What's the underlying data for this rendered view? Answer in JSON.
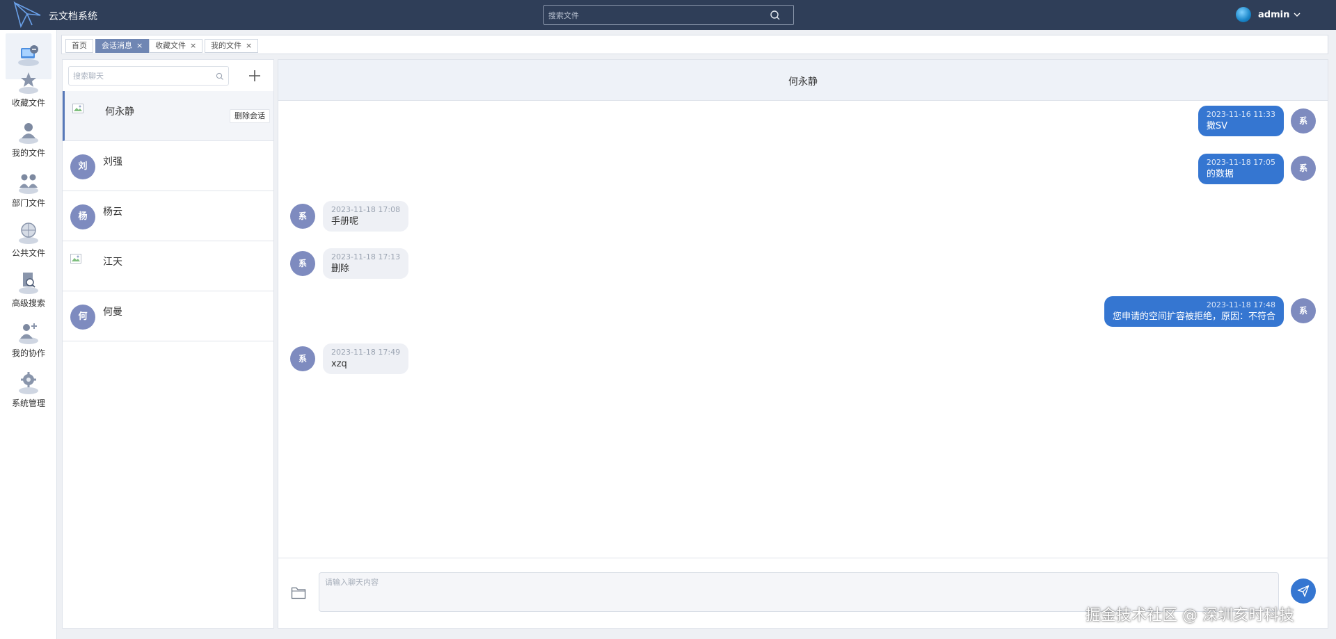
{
  "app": {
    "title": "云文档系统",
    "brand_color": "#2f3e58",
    "accent_color": "#3576d1"
  },
  "header": {
    "search_placeholder": "搜索文件",
    "search_icon": "search-icon",
    "user_name": "admin"
  },
  "sidebar": {
    "items": [
      {
        "label": "",
        "icon": "chat-computer-icon",
        "active": true
      },
      {
        "label": "收藏文件",
        "icon": "favorite-files-icon"
      },
      {
        "label": "我的文件",
        "icon": "my-files-icon"
      },
      {
        "label": "部门文件",
        "icon": "department-files-icon"
      },
      {
        "label": "公共文件",
        "icon": "public-files-icon"
      },
      {
        "label": "高级搜索",
        "icon": "advanced-search-icon"
      },
      {
        "label": "我的协作",
        "icon": "collaboration-icon"
      },
      {
        "label": "系统管理",
        "icon": "system-admin-icon"
      }
    ]
  },
  "tabs": [
    {
      "label": "首页",
      "closable": false,
      "active": false
    },
    {
      "label": "会话消息",
      "closable": true,
      "active": true
    },
    {
      "label": "收藏文件",
      "closable": true,
      "active": false
    },
    {
      "label": "我的文件",
      "closable": true,
      "active": false
    }
  ],
  "tab_close_glyph": "×",
  "chat_list": {
    "search_placeholder": "搜索聊天",
    "add_glyph": "+",
    "delete_label": "删除会话",
    "conversations": [
      {
        "name": "何永静",
        "avatar_text": "",
        "avatar_broken": true,
        "active": true
      },
      {
        "name": "刘强",
        "avatar_text": "刘",
        "avatar_broken": false
      },
      {
        "name": "杨云",
        "avatar_text": "杨",
        "avatar_broken": false
      },
      {
        "name": "江天",
        "avatar_text": "",
        "avatar_broken": true
      },
      {
        "name": "何曼",
        "avatar_text": "何",
        "avatar_broken": false
      }
    ]
  },
  "chat": {
    "title": "何永静",
    "messages": [
      {
        "direction": "out",
        "time": "2023-11-16 11:33",
        "text": "撒SV",
        "avatar_text": "系"
      },
      {
        "direction": "out",
        "time": "2023-11-18 17:05",
        "text": "的数据",
        "avatar_text": "系"
      },
      {
        "direction": "in",
        "time": "2023-11-18 17:08",
        "text": "手册呢",
        "avatar_text": "系"
      },
      {
        "direction": "in",
        "time": "2023-11-18 17:13",
        "text": "删除",
        "avatar_text": "系"
      },
      {
        "direction": "out",
        "time": "2023-11-18 17:48",
        "text": "您申请的空间扩容被拒绝，原因：不符合",
        "avatar_text": "系"
      },
      {
        "direction": "in",
        "time": "2023-11-18 17:49",
        "text": "xzq",
        "avatar_text": "系"
      }
    ],
    "input_placeholder": "请输入聊天内容"
  },
  "watermark": "掘金技术社区 @ 深圳亥时科技"
}
